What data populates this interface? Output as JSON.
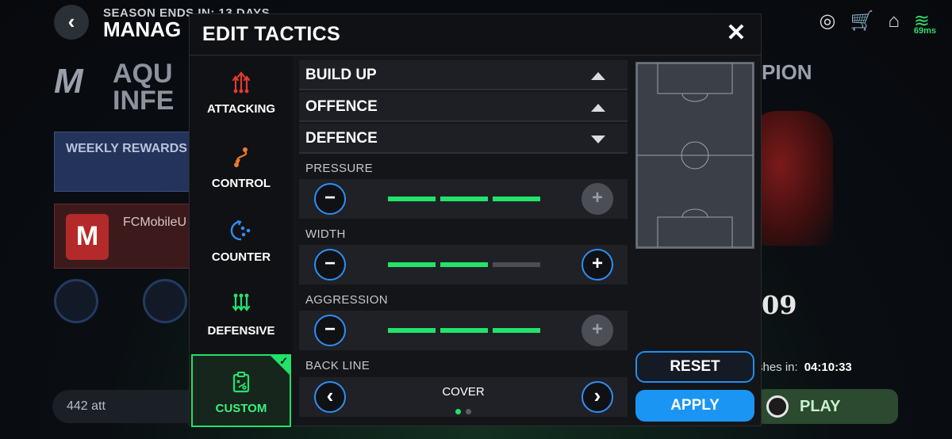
{
  "background": {
    "back_icon": "chevron-left-icon",
    "season_text": "SEASON ENDS IN: 13 DAYS",
    "manage_text": "MANAG",
    "ping": "69ms",
    "logo_text": "M",
    "event_title_line1": "AQU",
    "event_title_line2": "INFE",
    "weekly_rewards": "WEEKLY REWARDS",
    "club_name": "FCMobileU",
    "club_badge": "M",
    "right_title": "PION",
    "right_number": "09",
    "att_text": "442 att",
    "finishes_label": "shes in:",
    "finishes_time": "04:10:33",
    "play_label": "PLAY"
  },
  "modal": {
    "title": "EDIT TACTICS",
    "close_icon": "✕"
  },
  "tabs": [
    {
      "label": "ATTACKING",
      "icon": "attacking-icon",
      "color": "#e53b2f",
      "selected": false
    },
    {
      "label": "CONTROL",
      "icon": "control-icon",
      "color": "#f07b2a",
      "selected": false
    },
    {
      "label": "COUNTER",
      "icon": "counter-icon",
      "color": "#2f8ef5",
      "selected": false
    },
    {
      "label": "DEFENSIVE",
      "icon": "defensive-icon",
      "color": "#23e36b",
      "selected": false
    },
    {
      "label": "CUSTOM",
      "icon": "custom-icon",
      "color": "#23e36b",
      "selected": true
    }
  ],
  "sections": {
    "build_up": "BUILD UP",
    "offence": "OFFENCE",
    "defence": "DEFENCE"
  },
  "settings": {
    "pressure": {
      "label": "PRESSURE",
      "level": 3,
      "max": 3
    },
    "width": {
      "label": "WIDTH",
      "level": 2,
      "max": 3
    },
    "aggression": {
      "label": "AGGRESSION",
      "level": 3,
      "max": 3
    },
    "back_line": {
      "label": "BACK LINE",
      "value": "COVER",
      "option_index": 1,
      "option_count": 2
    }
  },
  "buttons": {
    "minus": "−",
    "plus": "+",
    "prev": "‹",
    "next": "›",
    "reset": "RESET",
    "apply": "APPLY"
  },
  "colors": {
    "accent_green": "#23e36b",
    "accent_blue": "#1b95f3"
  }
}
